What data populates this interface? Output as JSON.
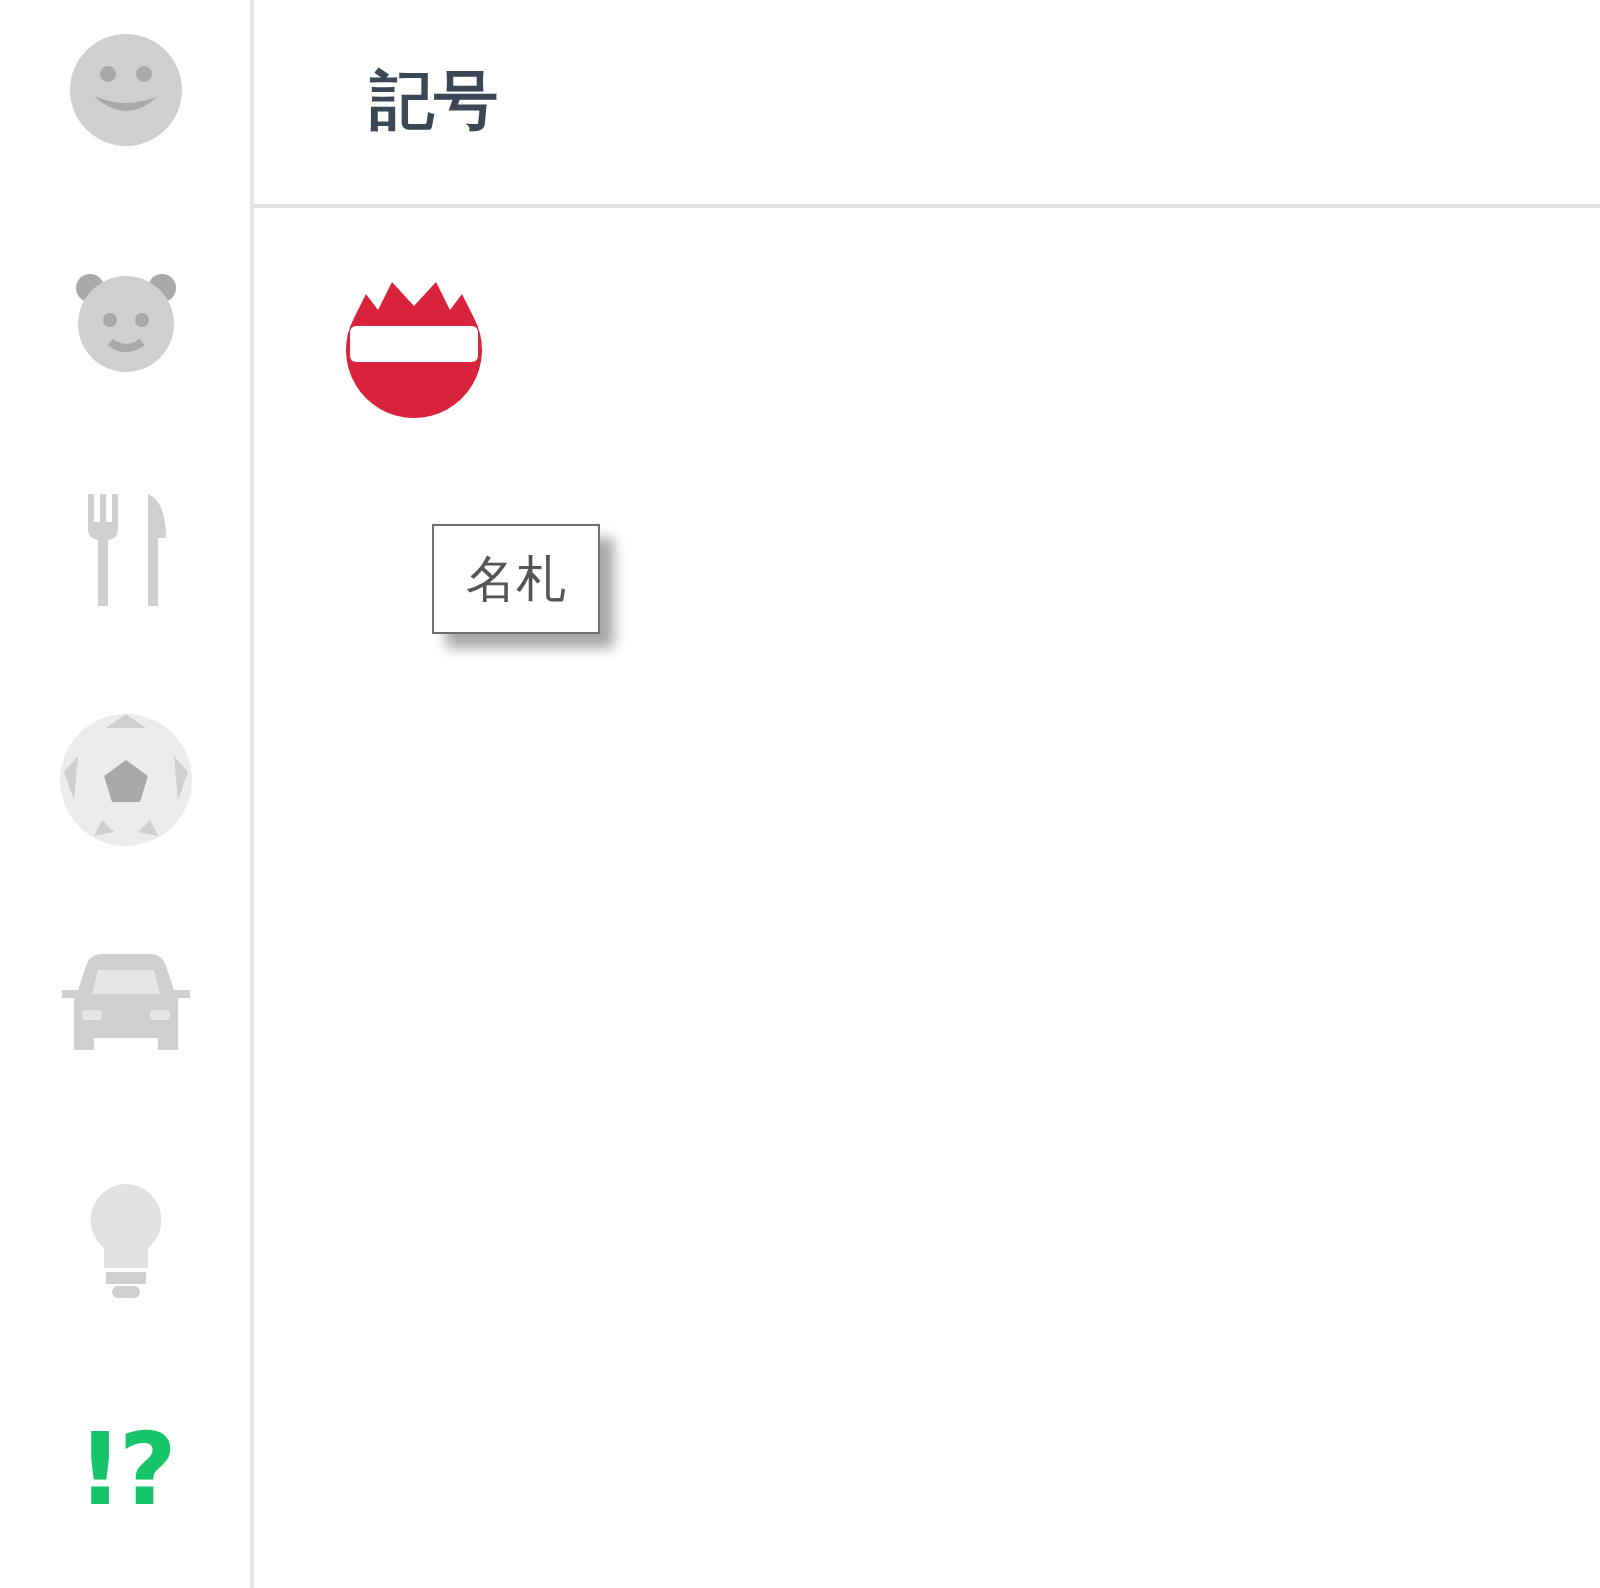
{
  "sidebar": {
    "categories": [
      {
        "kind": "smiley",
        "selected": false
      },
      {
        "kind": "animal",
        "selected": false
      },
      {
        "kind": "food",
        "selected": false
      },
      {
        "kind": "sport",
        "selected": false
      },
      {
        "kind": "vehicle",
        "selected": false
      },
      {
        "kind": "object",
        "selected": false
      },
      {
        "kind": "symbol",
        "label": "!?",
        "selected": true
      }
    ]
  },
  "panel": {
    "title": "記号",
    "emojis": [
      {
        "kind": "name_badge",
        "tooltip": "名札"
      }
    ]
  }
}
